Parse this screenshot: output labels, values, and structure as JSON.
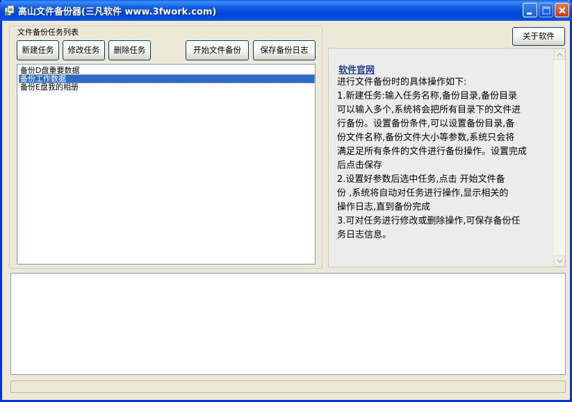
{
  "window": {
    "title": "高山文件备份器(三凡软件 www.3fwork.com)"
  },
  "task_group": {
    "legend": "文件备份任务列表",
    "buttons": {
      "new": "新建任务",
      "edit": "修改任务",
      "delete": "删除任务",
      "start": "开始文件备份",
      "save_log": "保存备份日志"
    },
    "tasks": [
      {
        "label": "备份D盘重要数据",
        "selected": false
      },
      {
        "label": "备份工作数据",
        "selected": true
      },
      {
        "label": "备份E盘我的相册",
        "selected": false
      }
    ]
  },
  "about_button": "关于软件",
  "info": {
    "link": "软件官网",
    "lines": [
      "进行文件备份时的具体操作如下:",
      "1.新建任务:输入任务名称,备份目录,备份目录",
      "可以输入多个,系统将会把所有目录下的文件进",
      "行备份。设置备份条件,可以设置备份目录,备",
      "份文件名称,备份文件大小等参数,系统只会将",
      "满足足所有条件的文件进行备份操作。设置完成",
      "后点击保存",
      "2.设置好参数后选中任务,点击 开始文件备",
      "份 ,系统将自动对任务进行操作,显示相关的",
      "操作日志,直到备份完成",
      "3.可对任务进行修改或删除操作,可保存备份任",
      "务日志信息。"
    ]
  },
  "log": "",
  "status": ""
}
